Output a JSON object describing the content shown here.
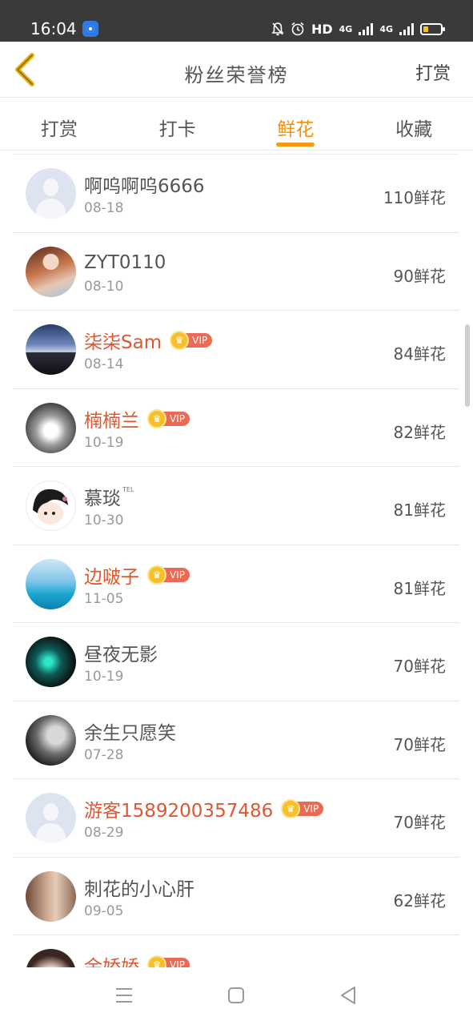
{
  "status": {
    "time": "16:04",
    "mute_icon": "bell-off-icon",
    "alarm_icon": "alarm-icon",
    "hd_label": "HD",
    "net1_label": "4G",
    "net2_label": "4G",
    "battery_level": 0.2,
    "colors": {
      "bar": "#3a3a3a",
      "battery": "#f5c518"
    }
  },
  "header": {
    "back_icon": "chevron-left-icon",
    "title": "粉丝荣誉榜",
    "action_label": "打赏"
  },
  "tabs": [
    {
      "label": "打赏",
      "active": false
    },
    {
      "label": "打卡",
      "active": false
    },
    {
      "label": "鲜花",
      "active": true
    },
    {
      "label": "收藏",
      "active": false
    }
  ],
  "vip_label": "VIP",
  "tel_label": "TEL",
  "fans": [
    {
      "name": "啊呜啊呜6666",
      "date": "08-18",
      "count": "110鲜花",
      "vip": false,
      "avatar": "default-avatar"
    },
    {
      "name": "ZYT0110",
      "date": "08-10",
      "count": "90鲜花",
      "vip": false,
      "avatar": "photo-avatar"
    },
    {
      "name": "柒柒Sam",
      "date": "08-14",
      "count": "84鲜花",
      "vip": true,
      "avatar": "photo-avatar"
    },
    {
      "name": "楠楠兰",
      "date": "10-19",
      "count": "82鲜花",
      "vip": true,
      "avatar": "photo-avatar"
    },
    {
      "name": "慕琰",
      "date": "10-30",
      "count": "81鲜花",
      "vip": false,
      "avatar": "cartoon-avatar"
    },
    {
      "name": "边啵子",
      "date": "11-05",
      "count": "81鲜花",
      "vip": true,
      "avatar": "photo-avatar"
    },
    {
      "name": "昼夜无影",
      "date": "10-19",
      "count": "70鲜花",
      "vip": false,
      "avatar": "photo-avatar"
    },
    {
      "name": "余生只愿笑",
      "date": "07-28",
      "count": "70鲜花",
      "vip": false,
      "avatar": "photo-avatar"
    },
    {
      "name": "游客1589200357486",
      "date": "08-29",
      "count": "70鲜花",
      "vip": true,
      "avatar": "default-avatar"
    },
    {
      "name": "刺花的小心肝",
      "date": "09-05",
      "count": "62鲜花",
      "vip": false,
      "avatar": "photo-avatar"
    },
    {
      "name": "余娇娇",
      "date": "",
      "count": "",
      "vip": true,
      "avatar": "photo-avatar"
    }
  ],
  "nav": {
    "menu_icon": "menu-icon",
    "home_icon": "home-square-icon",
    "back_icon": "triangle-back-icon"
  },
  "colors": {
    "accent": "#f0900e",
    "vip_name": "#e0562f",
    "vip_badge": "#ec6a55",
    "crown": "#f7bf2a"
  }
}
